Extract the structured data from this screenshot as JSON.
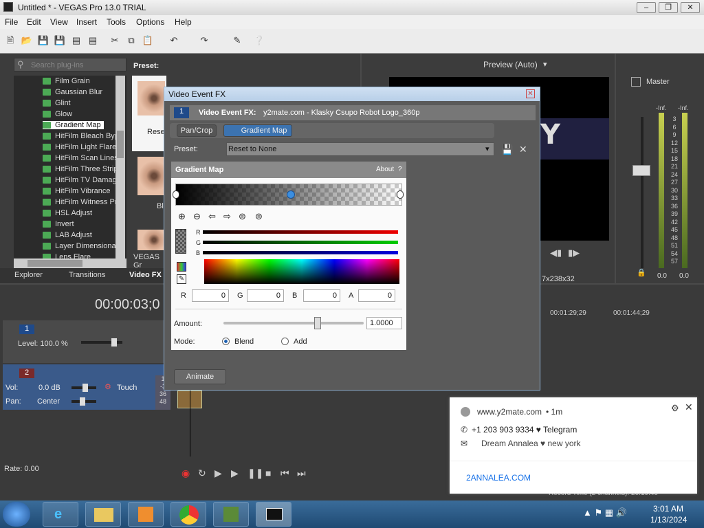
{
  "window": {
    "title": "Untitled * - VEGAS Pro 13.0 TRIAL"
  },
  "menu": [
    "File",
    "Edit",
    "View",
    "Insert",
    "Tools",
    "Options",
    "Help"
  ],
  "plugins": {
    "search_placeholder": "Search plug-ins",
    "items": [
      "Film Grain",
      "Gaussian Blur",
      "Glint",
      "Glow",
      "Gradient Map",
      "HitFilm Bleach Byp",
      "HitFilm Light Flares",
      "HitFilm Scan Lines",
      "HitFilm Three Strip",
      "HitFilm TV Damage",
      "HitFilm Vibrance",
      "HitFilm Witness Pr",
      "HSL Adjust",
      "Invert",
      "LAB Adjust",
      "Layer Dimensional",
      "Lens Flare"
    ],
    "selected": "Gradient Map"
  },
  "preset_panel": {
    "label": "Preset:",
    "thumb_labels": [
      "Reset",
      "Blu",
      "VEGAS Gr"
    ]
  },
  "bottom_tabs": [
    "Explorer",
    "Transitions",
    "Video FX"
  ],
  "preview": {
    "label": "Preview (Auto)",
    "resolution_text": "7x238x32"
  },
  "master": {
    "label": "Master",
    "scale": [
      "3",
      "6",
      "9",
      "12",
      "15",
      "18",
      "21",
      "24",
      "27",
      "30",
      "33",
      "36",
      "39",
      "42",
      "45",
      "48",
      "51",
      "54",
      "57"
    ],
    "levels": [
      "-Inf.",
      "-Inf."
    ],
    "values": [
      "0.0",
      "0.0"
    ]
  },
  "timeline": {
    "timecode": "00:00:03;0",
    "markers": [
      "00:01:29;29",
      "00:01:44;29"
    ],
    "track1": {
      "number": "1",
      "level": "Level: 100.0 %"
    },
    "track2": {
      "number": "2",
      "vol": "Vol:",
      "vol_value": "0.0 dB",
      "pan": "Pan:",
      "pan_value": "Center",
      "mode": "Touch",
      "clip_nums": [
        "1",
        "-3",
        "36",
        "48"
      ]
    },
    "rate": "Rate: 0.00",
    "record_time": "Record Time (2 channels): 20:19:40"
  },
  "dialog": {
    "title": "Video Event FX",
    "fx_label": "Video Event FX:",
    "fx_file": "y2mate.com - Klasky Csupo Robot Logo_360p",
    "chain": [
      "Pan/Crop",
      "Gradient Map"
    ],
    "preset_label": "Preset:",
    "preset_value": "Reset to None",
    "panel_title": "Gradient Map",
    "about": "About",
    "about_q": "?",
    "rgb_labels": [
      "R",
      "G",
      "B"
    ],
    "fields": [
      {
        "label": "R",
        "value": "0"
      },
      {
        "label": "G",
        "value": "0"
      },
      {
        "label": "B",
        "value": "0"
      },
      {
        "label": "A",
        "value": "0"
      }
    ],
    "amount_label": "Amount:",
    "amount_value": "1.0000",
    "amount_fraction": 0.67,
    "mode_label": "Mode:",
    "mode_options": [
      "Blend",
      "Add"
    ],
    "mode_selected": "Blend",
    "animate_button": "Animate"
  },
  "notification": {
    "source": "www.y2mate.com",
    "age": "• 1m",
    "line1": "+1 203 903 9334 ♥ Telegram",
    "line2": "Dream Annalea ♥ new york",
    "link": "2ANNALEA.COM"
  },
  "tray": {
    "time": "3:01 AM",
    "date": "1/13/2024"
  }
}
